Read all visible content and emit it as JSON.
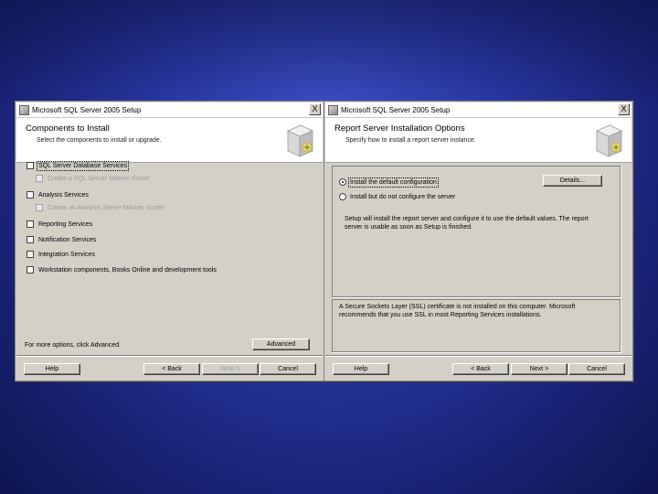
{
  "left_dialog": {
    "window_title": "Microsoft SQL Server 2005 Setup",
    "close_glyph": "X",
    "header_title": "Components to Install",
    "header_subtitle": "Select the components to install or upgrade.",
    "components": [
      {
        "label": "SQL Server Database Services",
        "checked": false,
        "enabled": true,
        "indent": false,
        "focused": true
      },
      {
        "label": "Create a SQL Server failover cluster",
        "checked": false,
        "enabled": false,
        "indent": true,
        "focused": false
      },
      {
        "label": "Analysis Services",
        "checked": false,
        "enabled": true,
        "indent": false,
        "focused": false
      },
      {
        "label": "Create an Analysis Server failover cluster",
        "checked": false,
        "enabled": false,
        "indent": true,
        "focused": false
      },
      {
        "label": "Reporting Services",
        "checked": false,
        "enabled": true,
        "indent": false,
        "focused": false
      },
      {
        "label": "Notification Services",
        "checked": false,
        "enabled": true,
        "indent": false,
        "focused": false
      },
      {
        "label": "Integration Services",
        "checked": false,
        "enabled": true,
        "indent": false,
        "focused": false
      },
      {
        "label": "Workstation components, Books Online and development tools",
        "checked": false,
        "enabled": true,
        "indent": false,
        "focused": false
      }
    ],
    "hint": "For more options, click Advanced.",
    "advanced_label": "Advanced",
    "help_label": "Help",
    "back_label": "< Back",
    "next_label": "Next >",
    "cancel_label": "Cancel"
  },
  "right_dialog": {
    "window_title": "Microsoft SQL Server 2005 Setup",
    "close_glyph": "X",
    "header_title": "Report Server Installation Options",
    "header_subtitle": "Specify how to install a report server instance.",
    "option_default": "Install the default configuration",
    "option_noconfig": "Install but do not configure the server",
    "details_label": "Details...",
    "description": "Setup will install the report server and configure it to use the default values. The report server is usable as soon as Setup is finished.",
    "warning": "A Secure Sockets Layer (SSL) certificate is not installed on this computer. Microsoft recommends that you use SSL in most Reporting Services installations.",
    "help_label": "Help",
    "back_label": "< Back",
    "next_label": "Next >",
    "cancel_label": "Cancel"
  },
  "colors": {
    "background": "#2a3aa8",
    "dialog_face": "#d4d0c8"
  }
}
